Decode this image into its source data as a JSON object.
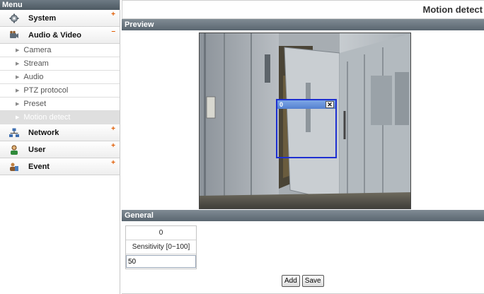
{
  "sidebar": {
    "header": "Menu",
    "items": [
      {
        "label": "System",
        "toggle": "+"
      },
      {
        "label": "Audio & Video",
        "toggle": "–",
        "subitems": [
          "Camera",
          "Stream",
          "Audio",
          "PTZ protocol",
          "Preset",
          "Motion detect"
        ]
      },
      {
        "label": "Network",
        "toggle": "+"
      },
      {
        "label": "User",
        "toggle": "+"
      },
      {
        "label": "Event",
        "toggle": "+"
      }
    ],
    "active_subitem": "Motion detect"
  },
  "main": {
    "page_title": "Motion detect",
    "preview_section": "Preview",
    "motion_box": {
      "id": "0",
      "close_glyph": "✕"
    },
    "general_section": "General",
    "table": {
      "col_header": "0",
      "sensitivity_label": "Sensitivity [0~100]",
      "sensitivity_value": "50"
    },
    "buttons": {
      "add": "Add",
      "save": "Save"
    }
  },
  "colors": {
    "accent_toggle": "#e05a00",
    "motion_box_border": "#1d2fd1",
    "section_bar": "#5a6670"
  },
  "icons": [
    "system-icon",
    "audio-video-icon",
    "network-icon",
    "user-icon",
    "event-icon"
  ]
}
